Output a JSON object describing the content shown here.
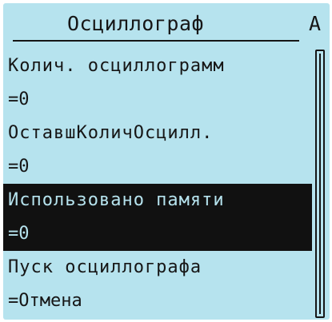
{
  "header": {
    "title": "Осциллограф",
    "flag": "А"
  },
  "menu": {
    "items": [
      {
        "label": "Колич. осциллограмм",
        "value": "=0"
      },
      {
        "label": "ОставшКоличОсцилл.",
        "value": "=0"
      },
      {
        "label": "Использовано памяти",
        "value": "=0"
      },
      {
        "label": "Пуск осциллографа",
        "value": "=Отмена"
      }
    ],
    "selected_index": 2
  },
  "colors": {
    "screen_background": "#b6e3ee",
    "text": "#161616",
    "highlight": "#111111"
  }
}
